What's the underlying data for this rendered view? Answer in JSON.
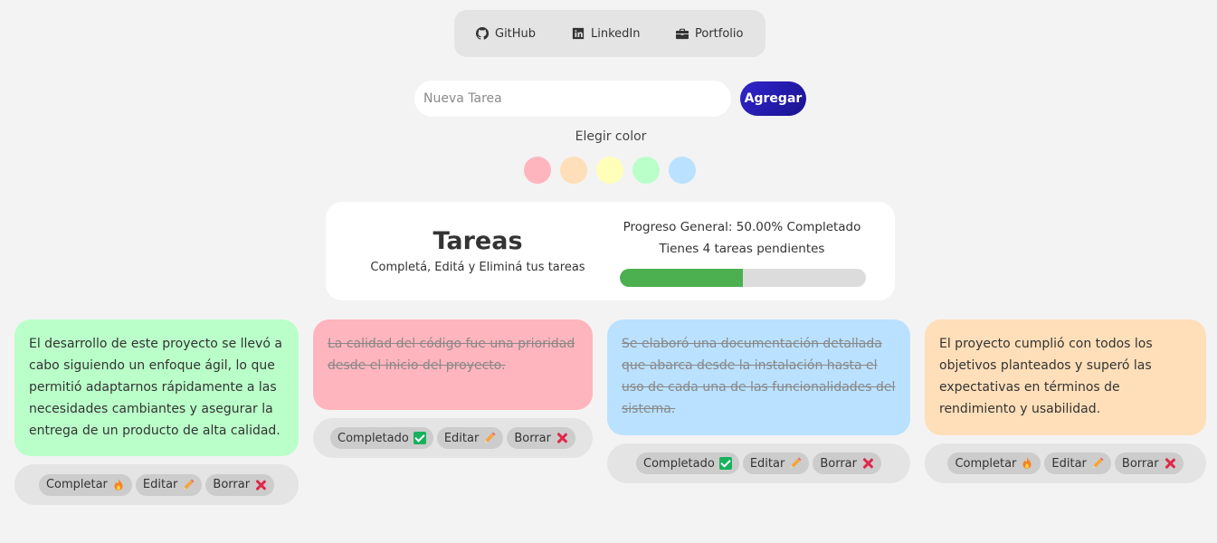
{
  "nav": {
    "links": [
      {
        "label": "GitHub",
        "icon": "github-icon"
      },
      {
        "label": "LinkedIn",
        "icon": "linkedin-icon"
      },
      {
        "label": "Portfolio",
        "icon": "briefcase-icon"
      }
    ]
  },
  "form": {
    "input_placeholder": "Nueva Tarea",
    "input_value": "",
    "add_label": "Agregar",
    "color_label": "Elegir color",
    "colors": [
      "#ffb5bd",
      "#ffdfb9",
      "#ffffba",
      "#baffc9",
      "#bae1ff"
    ]
  },
  "header": {
    "title": "Tareas",
    "subtitle": "Completá, Editá y Eliminá tus tareas",
    "progress_text": "Progreso General: 50.00% Completado",
    "pending_text": "Tienes 4 tareas pendientes",
    "progress": 0.5,
    "progress_color": "#4caf50"
  },
  "tasks": [
    {
      "text": "El desarrollo de este proyecto se llevó a cabo siguiendo un enfoque ágil, lo que permitió adaptarnos rápidamente a las necesidades cambiantes y asegurar la entrega de un producto de alta calidad.",
      "color": "#baffc9",
      "completed": false,
      "complete_label": "Completar",
      "edit_label": "Editar",
      "delete_label": "Borrar"
    },
    {
      "text": "La calidad del código fue una prioridad desde el inicio del proyecto.",
      "color": "#ffb5bd",
      "completed": true,
      "complete_label": "Completado",
      "edit_label": "Editar",
      "delete_label": "Borrar"
    },
    {
      "text": "Se elaboró una documentación detallada que abarca desde la instalación hasta el uso de cada una de las funcionalidades del sistema.",
      "color": "#bae1ff",
      "completed": true,
      "complete_label": "Completado",
      "edit_label": "Editar",
      "delete_label": "Borrar"
    },
    {
      "text": "El proyecto cumplió con todos los objetivos planteados y superó las expectativas en términos de rendimiento y usabilidad.",
      "color": "#ffdfb9",
      "completed": false,
      "complete_label": "Completar",
      "edit_label": "Editar",
      "delete_label": "Borrar"
    }
  ]
}
